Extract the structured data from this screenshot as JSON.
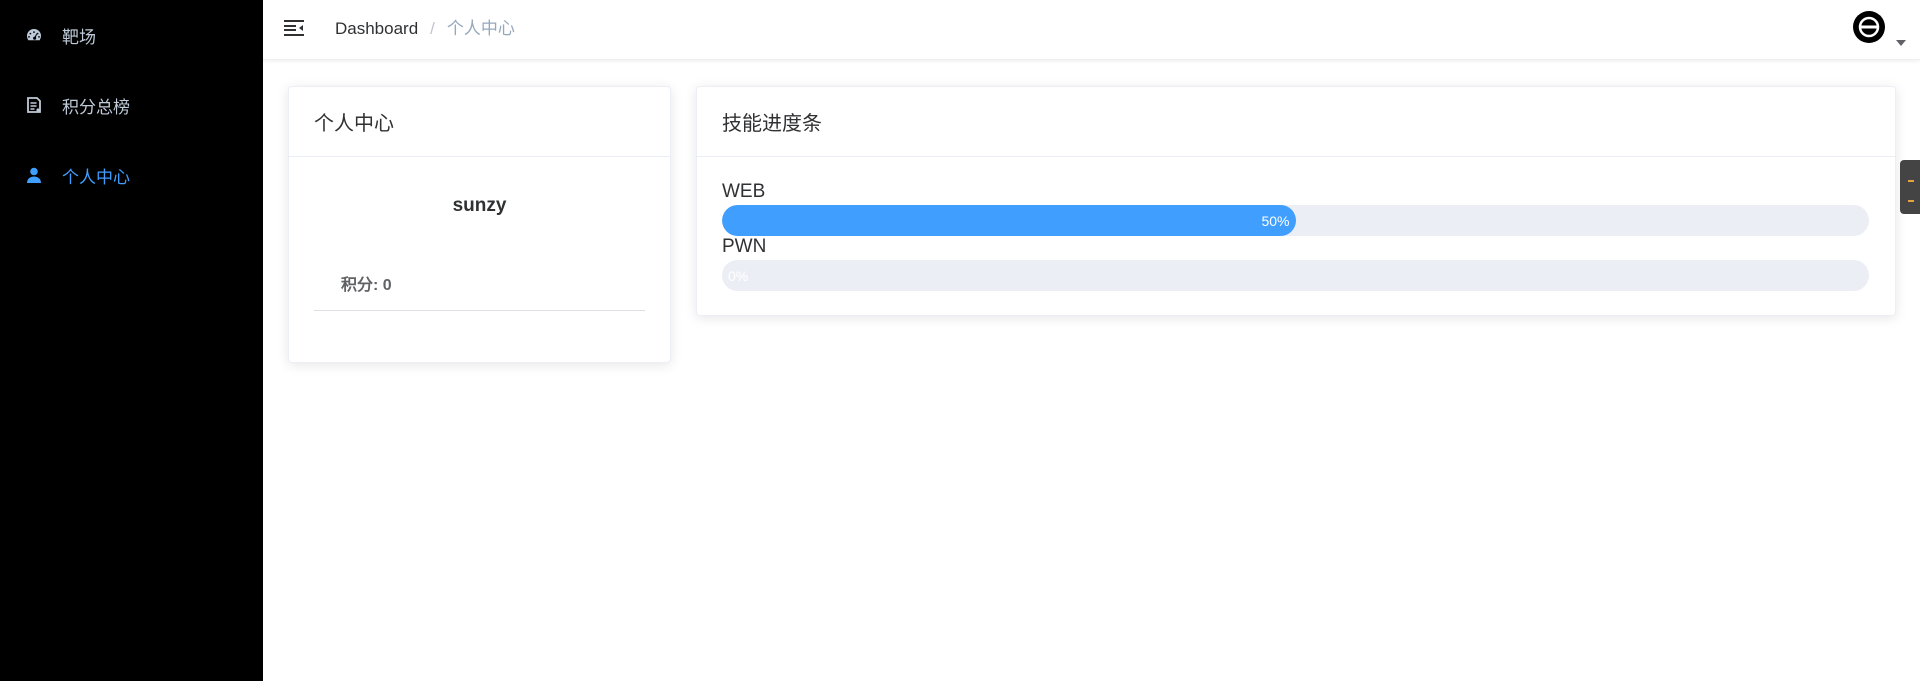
{
  "sidebar": {
    "items": [
      {
        "label": "靶场",
        "icon": "dashboard-icon"
      },
      {
        "label": "积分总榜",
        "icon": "scoreboard-icon"
      },
      {
        "label": "个人中心",
        "icon": "user-icon",
        "active": true
      }
    ]
  },
  "header": {
    "breadcrumb": [
      "Dashboard",
      "个人中心"
    ],
    "separator": "/"
  },
  "profile": {
    "title": "个人中心",
    "username": "sunzy",
    "score_label": "积分: ",
    "score_value": "0"
  },
  "skills": {
    "title": "技能进度条",
    "items": [
      {
        "name": "WEB",
        "percent": 50,
        "text": "50%"
      },
      {
        "name": "PWN",
        "percent": 0,
        "text": "0%"
      }
    ]
  },
  "colors": {
    "accent": "#409eff",
    "sidebar_bg": "#000000",
    "sidebar_text": "#bfcbd9",
    "track": "#ebeef5"
  }
}
